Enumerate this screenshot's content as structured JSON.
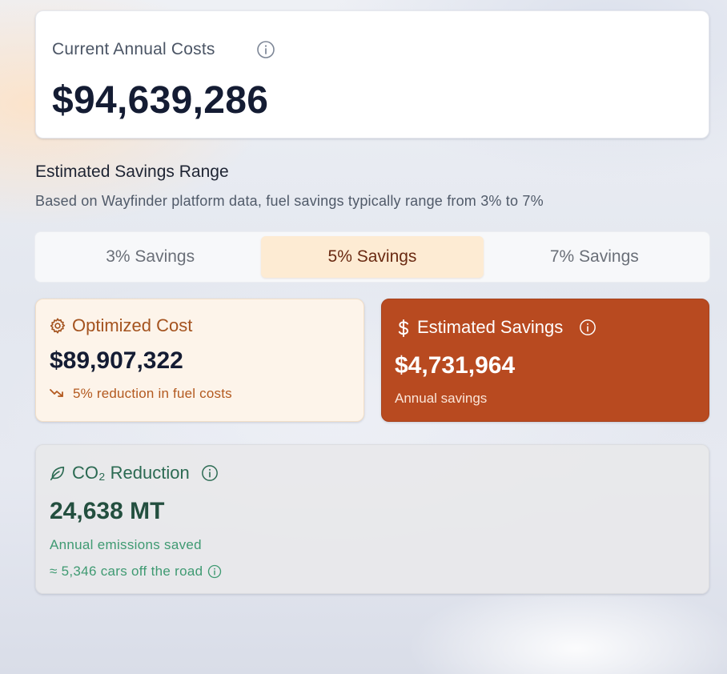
{
  "current": {
    "label": "Current Annual Costs",
    "value": "$94,639,286"
  },
  "range": {
    "title": "Estimated Savings Range",
    "description": "Based on Wayfinder platform data, fuel savings typically range from 3% to 7%"
  },
  "tabs": [
    {
      "label": "3% Savings",
      "active": false
    },
    {
      "label": "5% Savings",
      "active": true
    },
    {
      "label": "7% Savings",
      "active": false
    }
  ],
  "optimized": {
    "title": "Optimized Cost",
    "value": "$89,907,322",
    "note": "5% reduction in fuel costs",
    "icon": "gear-icon"
  },
  "estimated": {
    "title": "Estimated Savings",
    "value": "$4,731,964",
    "sub": "Annual savings",
    "icon": "dollar-icon"
  },
  "co2": {
    "title": "CO₂ Reduction",
    "value": "24,638 MT",
    "sub": "Annual emissions saved",
    "cars": "≈ 5,346 cars off the road",
    "icon": "leaf-icon"
  },
  "colors": {
    "accent": "#b84a20",
    "tab_active_bg": "#fdebd3",
    "optimized_bg": "#fdf4ea",
    "green_text": "#3f9a72"
  }
}
